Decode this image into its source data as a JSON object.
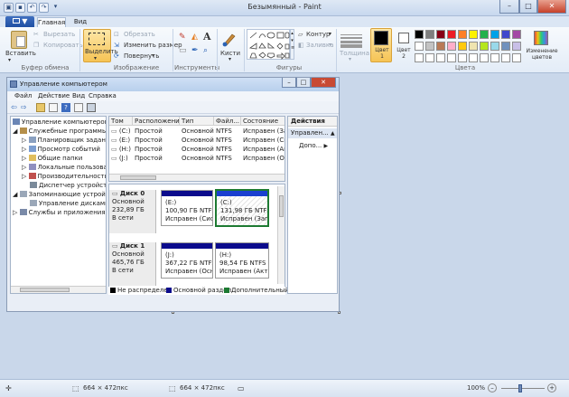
{
  "window": {
    "title": "Безымянный - Paint",
    "buttons": {
      "minimize": "–",
      "maximize": "□",
      "close": "✕"
    }
  },
  "menu": {
    "file_label": "▼"
  },
  "tabs": [
    {
      "label": "Главная"
    },
    {
      "label": "Вид"
    }
  ],
  "ribbon": {
    "groups": {
      "clipboard": "Буфер обмена",
      "image": "Изображение",
      "tools": "Инструменты",
      "shapes": "Фигуры",
      "colors": "Цвета"
    },
    "paste": "Вставить",
    "cut": "Вырезать",
    "copy": "Копировать",
    "select": "Выделить",
    "crop": "Обрезать",
    "resize": "Изменить размер",
    "rotate": "Повернуть",
    "brushes": "Кисти",
    "outline": "Контур",
    "fill": "Заливка",
    "thickness": "Толщина",
    "color1": "Цвет 1",
    "color2": "Цвет 2",
    "edit_colors": "Изменение цветов",
    "text_tool": "A"
  },
  "palette": {
    "color1": "#000000",
    "color2": "#ffffff",
    "row1": [
      "#000000",
      "#7f7f7f",
      "#880015",
      "#ed1c24",
      "#ff7f27",
      "#fff200",
      "#22b14c",
      "#00a2e8",
      "#3f48cc",
      "#a349a4"
    ],
    "row2": [
      "#ffffff",
      "#c3c3c3",
      "#b97a57",
      "#ffaec9",
      "#ffc90e",
      "#efe4b0",
      "#b5e61d",
      "#99d9ea",
      "#7092be",
      "#c8bfe7"
    ],
    "row3": [
      "#ffffff",
      "#ffffff",
      "#ffffff",
      "#ffffff",
      "#ffffff",
      "#ffffff",
      "#ffffff",
      "#ffffff",
      "#ffffff",
      "#ffffff"
    ]
  },
  "cm": {
    "title": "Управление компьютером",
    "menu": [
      "Файл",
      "Действие",
      "Вид",
      "Справка"
    ],
    "tree": [
      "Управление компьютером (л",
      "Служебные программы",
      "Планировщик задань",
      "Просмотр событий",
      "Общие папки",
      "Локальные пользовате",
      "Производительность",
      "Диспетчер устройств",
      "Запоминающие устройст",
      "Управление дисками",
      "Службы и приложения"
    ],
    "columns": [
      "Том",
      "Расположение",
      "Тип",
      "Файл...",
      "Состояние"
    ],
    "rows": [
      [
        "(C:)",
        "Простой",
        "Основной",
        "NTFS",
        "Исправен (Загр"
      ],
      [
        "(E:)",
        "Простой",
        "Основной",
        "NTFS",
        "Исправен (Сис"
      ],
      [
        "(H:)",
        "Простой",
        "Основной",
        "NTFS",
        "Исправен (Акти"
      ],
      [
        "(J:)",
        "Простой",
        "Основной",
        "NTFS",
        "Исправен (Осно"
      ]
    ],
    "disks": [
      {
        "name": "Диск 0",
        "type": "Основной",
        "size": "232,89 ГБ",
        "status": "В сети",
        "parts": [
          {
            "letter": "(E:)",
            "size": "100,90 ГБ NTFS",
            "state": "Исправен (Систе"
          },
          {
            "letter": "(C:)",
            "size": "131,98 ГБ NTFS",
            "state": "Исправен (Загр"
          }
        ]
      },
      {
        "name": "Диск 1",
        "type": "Основной",
        "size": "465,76 ГБ",
        "status": "В сети",
        "parts": [
          {
            "letter": "(J:)",
            "size": "367,22 ГБ NTFS",
            "state": "Исправен (Основ"
          },
          {
            "letter": "(H:)",
            "size": "98,54 ГБ NTFS",
            "state": "Исправен (Актие"
          }
        ]
      }
    ],
    "legend": [
      "Не распределен",
      "Основной раздел",
      "Дополнительный"
    ],
    "actions": {
      "header": "Действия",
      "item1": "Управлен...",
      "item2": "Допо..."
    }
  },
  "status": {
    "canvas_size": "664 × 472пкс",
    "selection_size": "664 × 472пкс",
    "zoom": "100%"
  }
}
